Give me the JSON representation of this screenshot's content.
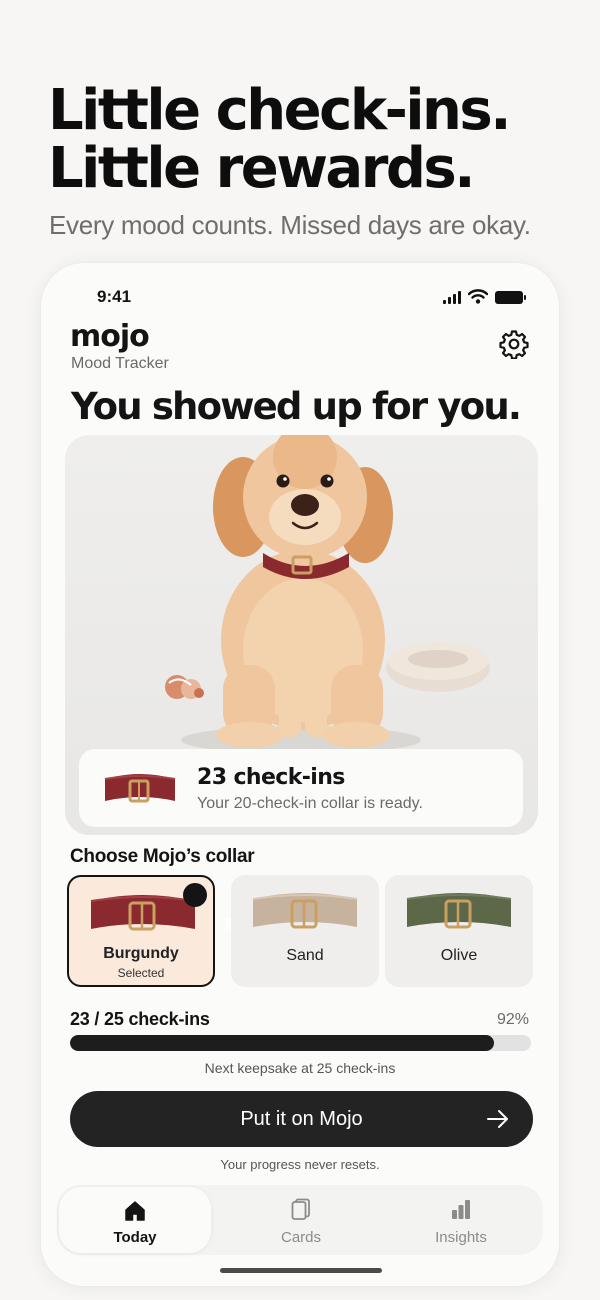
{
  "promo": {
    "headline_line1": "Little check-ins.",
    "headline_line2": "Little rewards.",
    "subhead": "Every mood counts. Missed days are okay."
  },
  "status_bar": {
    "time": "9:41"
  },
  "app": {
    "name": "mojo",
    "subtitle": "Mood Tracker"
  },
  "hero": {
    "title": "You showed up for you."
  },
  "reward": {
    "title": "23 check-ins",
    "subtitle": "Your 20-check-in collar is ready."
  },
  "collar_picker": {
    "title": "Choose Mojo’s collar",
    "options": [
      {
        "label": "Burgundy",
        "sub": "Selected",
        "color": "#8a2a2e",
        "selected": true
      },
      {
        "label": "Sand",
        "color": "#c7b39d",
        "selected": false
      },
      {
        "label": "Olive",
        "color": "#5c6848",
        "selected": false
      }
    ]
  },
  "progress": {
    "label": "23 / 25 check-ins",
    "percent_text": "92%",
    "fraction": 0.92,
    "next": "Next keepsake at 25 check-ins"
  },
  "cta": {
    "label": "Put it on Mojo"
  },
  "reassurance": "Your progress never resets.",
  "tabs": [
    {
      "label": "Today",
      "icon": "home-icon",
      "active": true
    },
    {
      "label": "Cards",
      "icon": "cards-icon",
      "active": false
    },
    {
      "label": "Insights",
      "icon": "bar-chart-icon",
      "active": false
    }
  ]
}
